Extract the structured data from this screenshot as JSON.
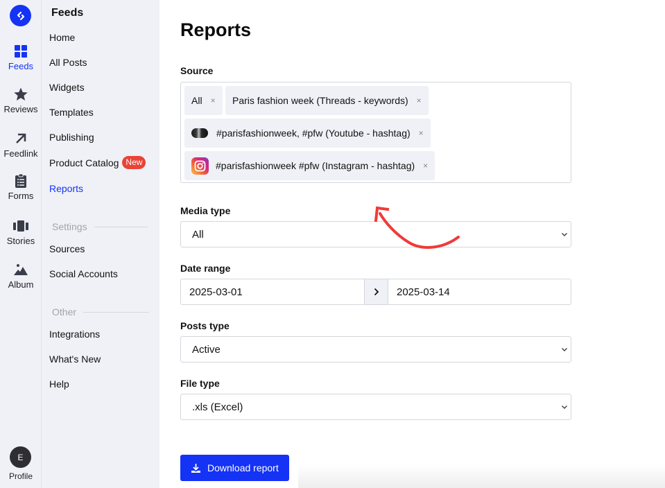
{
  "rail": {
    "logo_icon": "brand-logo-icon",
    "items": [
      {
        "label": "Feeds",
        "icon": "grid-icon",
        "active": true
      },
      {
        "label": "Reviews",
        "icon": "star-icon",
        "active": false
      },
      {
        "label": "Feedlink",
        "icon": "arrow-up-right-icon",
        "active": false
      },
      {
        "label": "Forms",
        "icon": "clipboard-list-icon",
        "active": false
      },
      {
        "label": "Stories",
        "icon": "stories-icon",
        "active": false
      },
      {
        "label": "Album",
        "icon": "image-icon",
        "active": false
      }
    ],
    "profile": {
      "initial": "E",
      "label": "Profile"
    }
  },
  "nav": {
    "title": "Feeds",
    "items": [
      {
        "label": "Home"
      },
      {
        "label": "All Posts"
      },
      {
        "label": "Widgets"
      },
      {
        "label": "Templates"
      },
      {
        "label": "Publishing"
      },
      {
        "label": "Product Catalog",
        "badge": "New"
      },
      {
        "label": "Reports",
        "active": true
      }
    ],
    "settings_section": "Settings",
    "settings_items": [
      {
        "label": "Sources"
      },
      {
        "label": "Social Accounts"
      }
    ],
    "other_section": "Other",
    "other_items": [
      {
        "label": "Integrations"
      },
      {
        "label": "What's New"
      },
      {
        "label": "Help"
      }
    ]
  },
  "main": {
    "title": "Reports",
    "source": {
      "label": "Source",
      "chips": [
        {
          "label": "All",
          "icon": null
        },
        {
          "label": "Paris fashion week (Threads - keywords)",
          "icon": null
        },
        {
          "label": "#parisfashionweek, #pfw (Youtube - hashtag)",
          "icon": "youtube-thumbnail"
        },
        {
          "label": "#parisfashionweek #pfw (Instagram - hashtag)",
          "icon": "instagram-icon"
        }
      ],
      "remove_glyph": "×"
    },
    "media_type": {
      "label": "Media type",
      "value": "All"
    },
    "date_range": {
      "label": "Date range",
      "start": "2025-03-01",
      "end": "2025-03-14"
    },
    "posts_type": {
      "label": "Posts type",
      "value": "Active"
    },
    "file_type": {
      "label": "File type",
      "value": ".xls (Excel)"
    },
    "download_button": "Download report"
  },
  "colors": {
    "accent": "#1433f5",
    "badge": "#eb4336",
    "annotation_arrow": "#f03a3a",
    "sidebar_bg": "#eff1f6"
  }
}
